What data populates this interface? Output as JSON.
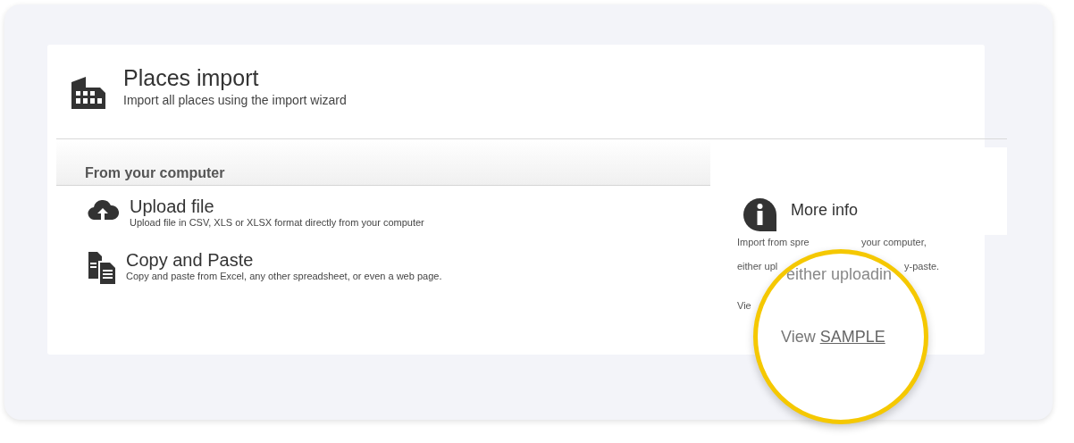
{
  "header": {
    "title": "Places import",
    "subtitle": "Import all places using the import wizard"
  },
  "section": {
    "title": "From your computer"
  },
  "options": [
    {
      "kind": "upload",
      "title": "Upload file",
      "description": "Upload file in CSV, XLS or XLSX format directly from your computer"
    },
    {
      "kind": "paste",
      "title": "Copy and Paste",
      "description": "Copy and paste from Excel, any other spreadsheet, or even a web page."
    }
  ],
  "info": {
    "title": "More info",
    "line_1_start": "Import from spre",
    "line_1_end": "your computer,",
    "line_2_start": "either upl",
    "line_2_end": "y-paste.",
    "line_3_start": "Vie"
  },
  "magnifier": {
    "text": "either uploadin",
    "view_label": "View",
    "link": "SAMPLE"
  }
}
